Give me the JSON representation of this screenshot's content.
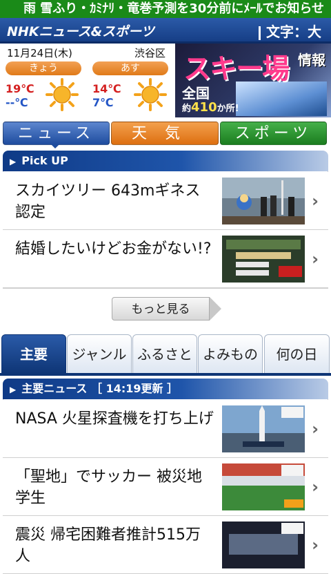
{
  "ticker": {
    "text": "雨 雪ふり・ｶﾐﾅﾘ・竜巻予測を30分前にﾒｰﾙでお知らせ"
  },
  "header": {
    "logo": "NHKニュース&スポーツ",
    "text_size": "文字：大"
  },
  "weather": {
    "date": "11月24日(木)",
    "place": "渋谷区",
    "days": [
      {
        "label": "きょう",
        "high": "19℃",
        "low": "--℃",
        "icon": "sun-icon"
      },
      {
        "label": "あす",
        "high": "14℃",
        "low": "7℃",
        "icon": "sun-icon"
      }
    ]
  },
  "ad": {
    "headline": "スキー場",
    "suffix": "情報",
    "line1": "全国",
    "count_prefix": "約",
    "count": "410",
    "count_suffix": "か所!"
  },
  "main_tabs": [
    {
      "label": "ニュース",
      "active": true
    },
    {
      "label": "天気"
    },
    {
      "label": "スポーツ"
    }
  ],
  "pickup": {
    "heading": "Pick UP",
    "items": [
      {
        "title": "スカイツリー 643mギネス認定"
      },
      {
        "title": "結婚したいけどお金がない!?"
      }
    ],
    "more_label": "もっと見る"
  },
  "sub_tabs": [
    {
      "label": "主要",
      "active": true
    },
    {
      "label": "ジャンル"
    },
    {
      "label": "ふるさと"
    },
    {
      "label": "よみもの"
    },
    {
      "label": "何の日"
    }
  ],
  "main_news": {
    "heading": "主要ニュース ［ 14:19更新 ］",
    "items": [
      {
        "title": "NASA 火星探査機を打ち上げ"
      },
      {
        "title": "「聖地」でサッカー 被災地学生"
      },
      {
        "title": "震災 帰宅困難者推計515万人"
      }
    ]
  },
  "colors": {
    "ticker": "#1a8a18",
    "header": "#163e86",
    "accent_orange": "#e07a18",
    "accent_green": "#1b7d1f",
    "hi_temp": "#d42020",
    "lo_temp": "#2456c6"
  }
}
